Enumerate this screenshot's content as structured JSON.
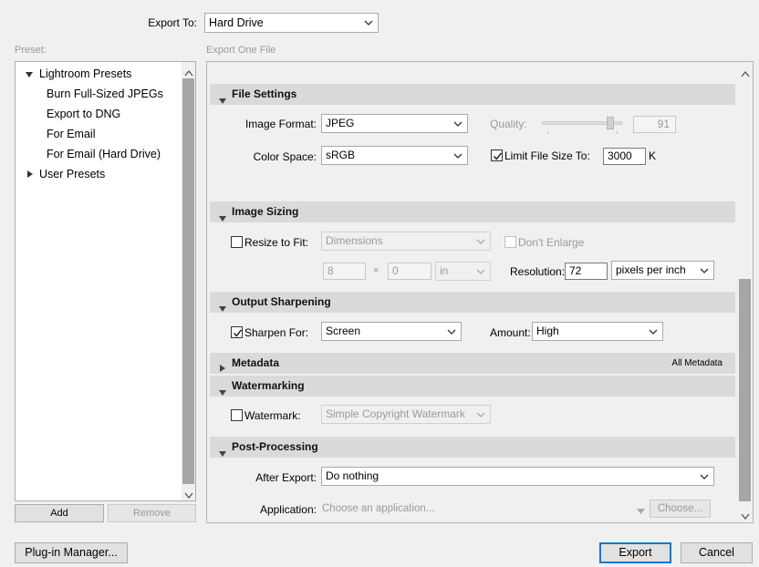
{
  "export_to": {
    "label": "Export To:",
    "value": "Hard Drive"
  },
  "preset_panel": {
    "label": "Preset:",
    "groups": [
      {
        "name": "Lightroom Presets",
        "expanded": true,
        "items": [
          "Burn Full-Sized JPEGs",
          "Export to DNG",
          "For Email",
          "For Email (Hard Drive)"
        ]
      },
      {
        "name": "User Presets",
        "expanded": false,
        "items": []
      }
    ],
    "add_label": "Add",
    "remove_label": "Remove"
  },
  "main_panel": {
    "label": "Export One File"
  },
  "file_settings": {
    "title": "File Settings",
    "image_format_label": "Image Format:",
    "image_format_value": "JPEG",
    "quality_label": "Quality:",
    "quality_value": "91",
    "color_space_label": "Color Space:",
    "color_space_value": "sRGB",
    "limit_size_label": "Limit File Size To:",
    "limit_size_checked": true,
    "limit_size_value": "3000",
    "limit_size_unit": "K"
  },
  "image_sizing": {
    "title": "Image Sizing",
    "resize_label": "Resize to Fit:",
    "resize_checked": false,
    "resize_mode": "Dimensions",
    "dont_enlarge_label": "Don't Enlarge",
    "width_value": "8",
    "times": "×",
    "height_value": "0",
    "unit_value": "in",
    "resolution_label": "Resolution:",
    "resolution_value": "72",
    "resolution_unit": "pixels per inch"
  },
  "output_sharpening": {
    "title": "Output Sharpening",
    "sharpen_label": "Sharpen For:",
    "sharpen_checked": true,
    "sharpen_value": "Screen",
    "amount_label": "Amount:",
    "amount_value": "High"
  },
  "metadata": {
    "title": "Metadata",
    "summary": "All Metadata"
  },
  "watermarking": {
    "title": "Watermarking",
    "watermark_label": "Watermark:",
    "watermark_checked": false,
    "watermark_value": "Simple Copyright Watermark"
  },
  "post_processing": {
    "title": "Post-Processing",
    "after_export_label": "After Export:",
    "after_export_value": "Do nothing",
    "application_label": "Application:",
    "application_placeholder": "Choose an application...",
    "choose_label": "Choose..."
  },
  "footer": {
    "plugin_manager_label": "Plug-in Manager...",
    "export_label": "Export",
    "cancel_label": "Cancel"
  },
  "colors": {
    "accent": "#0078d7",
    "section_header": "#dadada",
    "scrollbar_thumb": "#a6a6a6"
  }
}
